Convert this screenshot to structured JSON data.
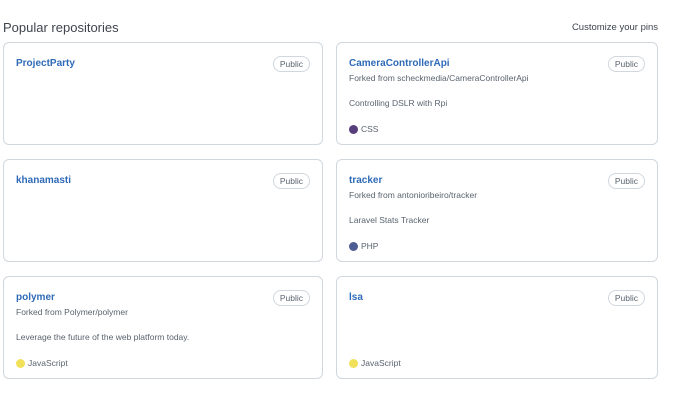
{
  "header": {
    "title": "Popular repositories",
    "customize_label": "Customize your pins"
  },
  "repos": [
    {
      "name": "ProjectParty",
      "visibility": "Public",
      "forked_from": "",
      "description": "",
      "language": "",
      "language_color": ""
    },
    {
      "name": "CameraControllerApi",
      "visibility": "Public",
      "forked_from": "Forked from scheckmedia/CameraControllerApi",
      "description": "Controlling DSLR with Rpi",
      "language": "CSS",
      "language_color": "#563d7c"
    },
    {
      "name": "khanamasti",
      "visibility": "Public",
      "forked_from": "",
      "description": "",
      "language": "",
      "language_color": ""
    },
    {
      "name": "tracker",
      "visibility": "Public",
      "forked_from": "Forked from antonioribeiro/tracker",
      "description": "Laravel Stats Tracker",
      "language": "PHP",
      "language_color": "#4F5D95"
    },
    {
      "name": "polymer",
      "visibility": "Public",
      "forked_from": "Forked from Polymer/polymer",
      "description": "Leverage the future of the web platform today.",
      "language": "JavaScript",
      "language_color": "#f1e05a"
    },
    {
      "name": "lsa",
      "visibility": "Public",
      "forked_from": "",
      "description": "",
      "language": "JavaScript",
      "language_color": "#f1e05a"
    }
  ]
}
